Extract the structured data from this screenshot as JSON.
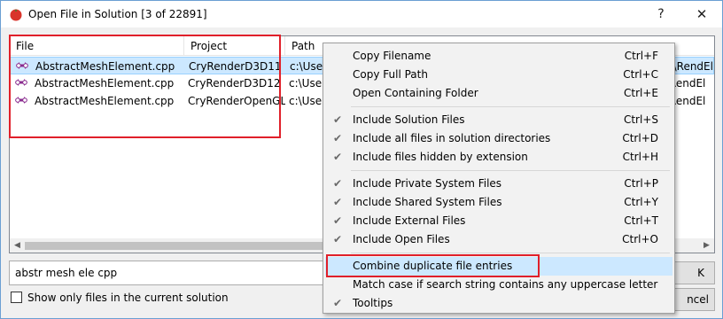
{
  "window": {
    "title": "Open File in Solution [3 of 22891]",
    "help_glyph": "?",
    "close_glyph": "✕"
  },
  "list": {
    "columns": [
      "File",
      "Project",
      "Path"
    ],
    "rows": [
      {
        "file": "AbstractMeshElement.cpp",
        "project": "CryRenderD3D11",
        "path": "c:\\User",
        "path_tail": "n\\RendEl"
      },
      {
        "file": "AbstractMeshElement.cpp",
        "project": "CryRenderD3D12",
        "path": "c:\\User",
        "path_tail": "\\RendEl"
      },
      {
        "file": "AbstractMeshElement.cpp",
        "project": "CryRenderOpenGL",
        "path": "c:\\User",
        "path_tail": "\\RendEl"
      }
    ]
  },
  "search": {
    "value": "abstr mesh ele cpp"
  },
  "checkbox": {
    "label": "Show only files in the current solution",
    "checked": false
  },
  "buttons": {
    "ok": "OK",
    "ok_visible": "K",
    "cancel": "Cancel",
    "cancel_visible": "ncel"
  },
  "menu": {
    "items": [
      {
        "label": "Copy Filename",
        "shortcut": "Ctrl+F",
        "checked": false
      },
      {
        "label": "Copy Full Path",
        "shortcut": "Ctrl+C",
        "checked": false
      },
      {
        "label": "Open Containing Folder",
        "shortcut": "Ctrl+E",
        "checked": false
      },
      {
        "label": "Include Solution Files",
        "shortcut": "Ctrl+S",
        "checked": true
      },
      {
        "label": "Include all files in solution directories",
        "shortcut": "Ctrl+D",
        "checked": true
      },
      {
        "label": "Include files hidden by extension",
        "shortcut": "Ctrl+H",
        "checked": true
      },
      {
        "label": "Include Private System Files",
        "shortcut": "Ctrl+P",
        "checked": true
      },
      {
        "label": "Include Shared System Files",
        "shortcut": "Ctrl+Y",
        "checked": true
      },
      {
        "label": "Include External Files",
        "shortcut": "Ctrl+T",
        "checked": true
      },
      {
        "label": "Include Open Files",
        "shortcut": "Ctrl+O",
        "checked": true
      },
      {
        "label": "Combine duplicate file entries",
        "shortcut": "",
        "checked": false
      },
      {
        "label": "Match case if search string contains any uppercase letter",
        "shortcut": "",
        "checked": false
      },
      {
        "label": "Tooltips",
        "shortcut": "",
        "checked": true
      }
    ],
    "check_glyph": "✔"
  },
  "colors": {
    "highlight": "#cce8ff",
    "annotation_red": "#e0202a",
    "accent_blue": "#0078d7"
  }
}
